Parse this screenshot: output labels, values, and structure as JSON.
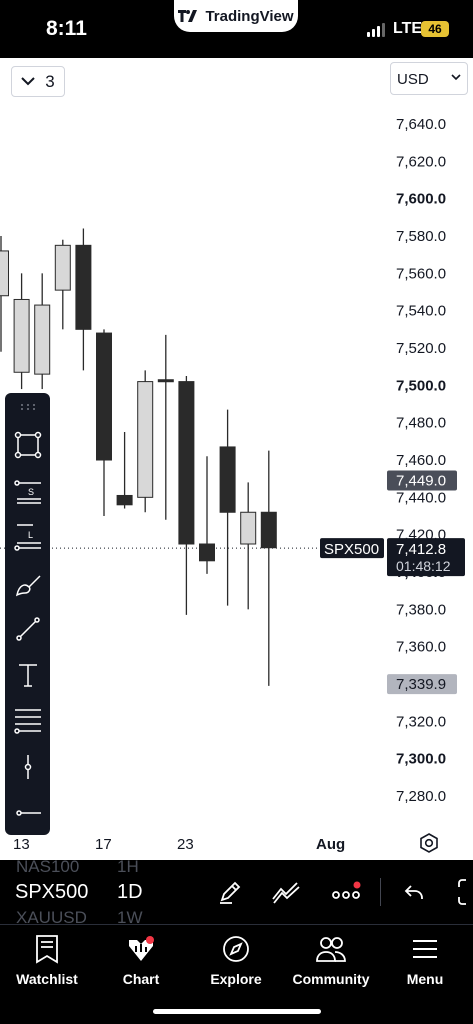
{
  "status": {
    "time": "8:11",
    "app": "TradingView",
    "network": "LTE",
    "battery": "46"
  },
  "chart_header": {
    "layout_count": "3",
    "currency": "USD"
  },
  "symbol_tag": "SPX500",
  "current_price": "7,412.8",
  "countdown": "01:48:12",
  "highlight_labels": {
    "high": "7,449.0",
    "low": "7,339.9"
  },
  "time_axis": [
    "13",
    "17",
    "23",
    "Aug"
  ],
  "bottom_toolbar": {
    "symbol": "SPX500",
    "timeframe": "1D",
    "ghost_symbols": [
      "NAS100",
      "XAUUSD"
    ],
    "ghost_timeframes": [
      "1H",
      "1W"
    ]
  },
  "tabs": [
    {
      "label": "Watchlist",
      "icon": "watchlist-icon"
    },
    {
      "label": "Chart",
      "icon": "chart-icon"
    },
    {
      "label": "Explore",
      "icon": "compass-icon"
    },
    {
      "label": "Community",
      "icon": "community-icon"
    },
    {
      "label": "Menu",
      "icon": "menu-icon"
    }
  ],
  "colors": {
    "bull": "#d8d8d8",
    "bear": "#2a2a2a",
    "accent_red": "#f23645"
  },
  "chart_data": {
    "type": "candlestick",
    "y_axis_labels": [
      "7,640.0",
      "7,620.0",
      "7,600.0",
      "7,580.0",
      "7,560.0",
      "7,540.0",
      "7,520.0",
      "7,500.0",
      "7,480.0",
      "7,460.0",
      "7,440.0",
      "7,420.0",
      "7,400.0",
      "7,380.0",
      "7,360.0",
      "7,340.0",
      "7,320.0",
      "7,300.0",
      "7,280.0"
    ],
    "ylim": [
      7272,
      7648
    ],
    "candles": [
      {
        "o": 7548,
        "h": 7580,
        "l": 7518,
        "c": 7572
      },
      {
        "o": 7507,
        "h": 7560,
        "l": 7498,
        "c": 7546
      },
      {
        "o": 7506,
        "h": 7560,
        "l": 7498,
        "c": 7543
      },
      {
        "o": 7551,
        "h": 7578,
        "l": 7530,
        "c": 7575
      },
      {
        "o": 7575,
        "h": 7584,
        "l": 7508,
        "c": 7530
      },
      {
        "o": 7528,
        "h": 7530,
        "l": 7430,
        "c": 7460
      },
      {
        "o": 7441,
        "h": 7475,
        "l": 7434,
        "c": 7436
      },
      {
        "o": 7440,
        "h": 7508,
        "l": 7432,
        "c": 7502
      },
      {
        "o": 7503,
        "h": 7527,
        "l": 7428,
        "c": 7502
      },
      {
        "o": 7502,
        "h": 7505,
        "l": 7377,
        "c": 7415
      },
      {
        "o": 7415,
        "h": 7462,
        "l": 7399,
        "c": 7406
      },
      {
        "o": 7467,
        "h": 7487,
        "l": 7382,
        "c": 7432
      },
      {
        "o": 7415,
        "h": 7448,
        "l": 7380,
        "c": 7432
      },
      {
        "o": 7432,
        "h": 7465,
        "l": 7339,
        "c": 7413
      }
    ]
  }
}
